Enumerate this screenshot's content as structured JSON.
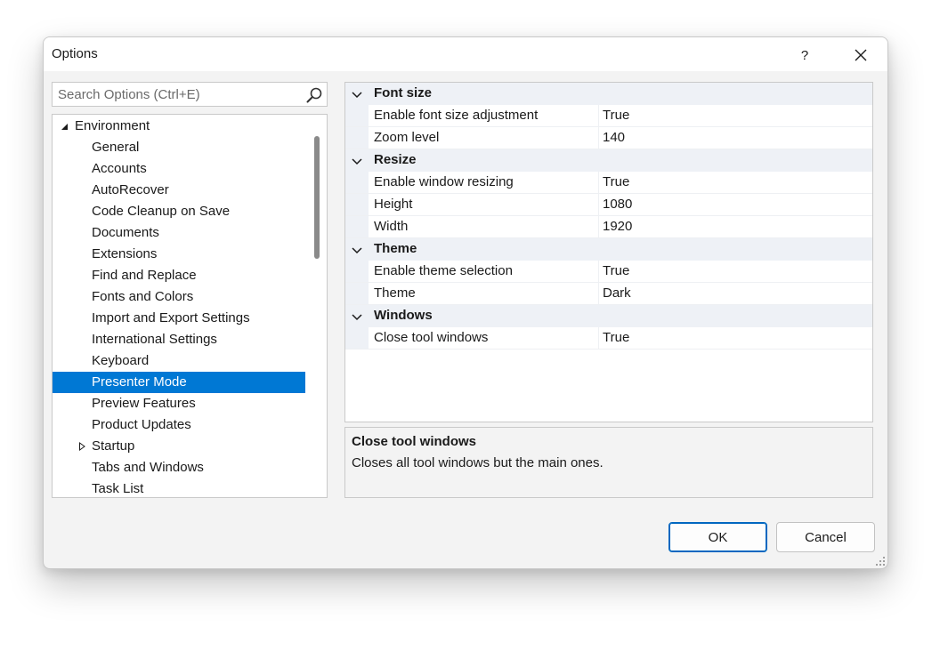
{
  "window": {
    "title": "Options",
    "help_label": "?"
  },
  "search": {
    "placeholder": "Search Options (Ctrl+E)"
  },
  "tree": {
    "items": [
      {
        "label": "Environment",
        "level": 0,
        "expander": "expanded"
      },
      {
        "label": "General",
        "level": 1
      },
      {
        "label": "Accounts",
        "level": 1
      },
      {
        "label": "AutoRecover",
        "level": 1
      },
      {
        "label": "Code Cleanup on Save",
        "level": 1
      },
      {
        "label": "Documents",
        "level": 1
      },
      {
        "label": "Extensions",
        "level": 1
      },
      {
        "label": "Find and Replace",
        "level": 1
      },
      {
        "label": "Fonts and Colors",
        "level": 1
      },
      {
        "label": "Import and Export Settings",
        "level": 1
      },
      {
        "label": "International Settings",
        "level": 1
      },
      {
        "label": "Keyboard",
        "level": 1
      },
      {
        "label": "Presenter Mode",
        "level": 1,
        "selected": true
      },
      {
        "label": "Preview Features",
        "level": 1
      },
      {
        "label": "Product Updates",
        "level": 1
      },
      {
        "label": "Startup",
        "level": 1,
        "expander": "collapsed"
      },
      {
        "label": "Tabs and Windows",
        "level": 1
      },
      {
        "label": "Task List",
        "level": 1
      }
    ]
  },
  "properties": {
    "categories": [
      {
        "label": "Font size",
        "rows": [
          {
            "name": "Enable font size adjustment",
            "value": "True"
          },
          {
            "name": "Zoom level",
            "value": "140"
          }
        ]
      },
      {
        "label": "Resize",
        "rows": [
          {
            "name": "Enable window resizing",
            "value": "True"
          },
          {
            "name": "Height",
            "value": "1080"
          },
          {
            "name": "Width",
            "value": "1920"
          }
        ]
      },
      {
        "label": "Theme",
        "rows": [
          {
            "name": "Enable theme selection",
            "value": "True"
          },
          {
            "name": "Theme",
            "value": "Dark"
          }
        ]
      },
      {
        "label": "Windows",
        "rows": [
          {
            "name": "Close tool windows",
            "value": "True"
          }
        ]
      }
    ]
  },
  "description": {
    "title": "Close tool windows",
    "text": "Closes all tool windows but the main ones."
  },
  "buttons": {
    "ok_label": "OK",
    "cancel_label": "Cancel"
  },
  "colors": {
    "accent": "#0078d4",
    "category_background": "#eef1f6",
    "dialog_background": "#f3f3f3"
  },
  "icons": {
    "search": "search-icon",
    "close": "close-icon",
    "category_expander": "chevron-down-icon",
    "tree_expanded": "triangle-expanded-icon",
    "tree_collapsed": "triangle-collapsed-icon",
    "resize_grip": "resize-grip-icon"
  }
}
